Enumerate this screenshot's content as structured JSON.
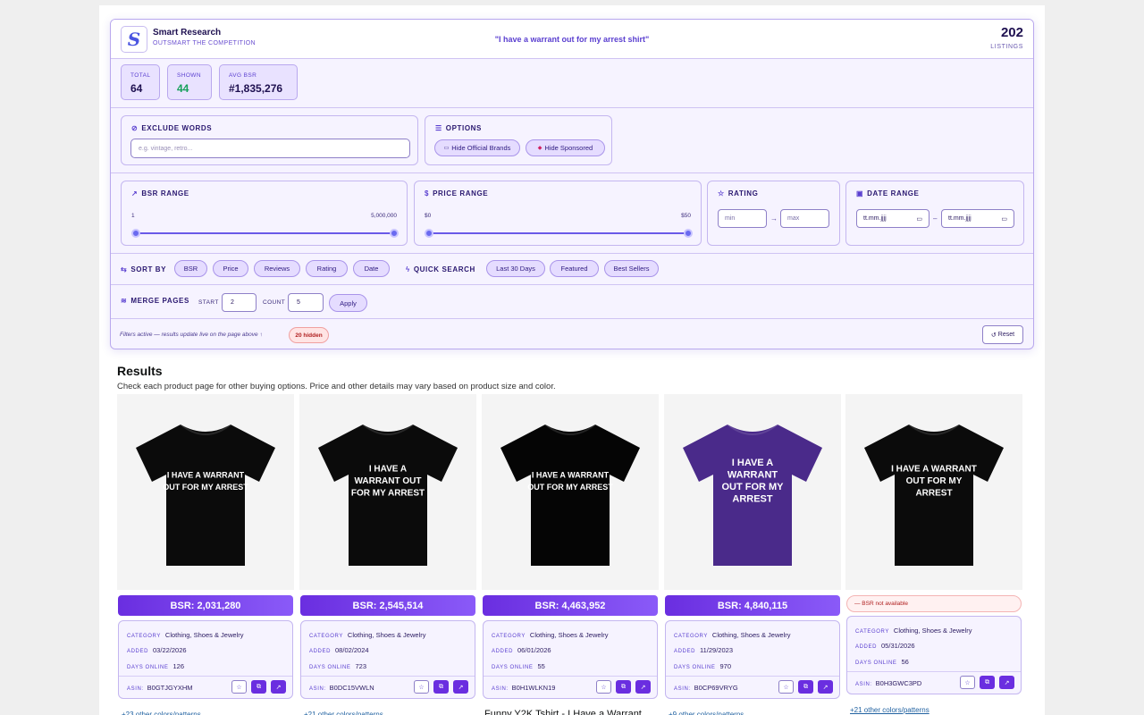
{
  "header": {
    "logo_letter": "S",
    "brand_name": "Smart Research",
    "tagline": "OUTSMART THE COMPETITION",
    "query": "\"I have a warrant out for my arrest shirt\"",
    "listing_count": "202",
    "listing_label": "LISTINGS"
  },
  "stats": [
    {
      "label": "TOTAL",
      "value": "64"
    },
    {
      "label": "SHOWN",
      "value": "44"
    },
    {
      "label": "AVG BSR",
      "value": "#1,835,276"
    }
  ],
  "exclude": {
    "title": "EXCLUDE WORDS",
    "placeholder": "e.g. vintage, retro..."
  },
  "options": {
    "title": "OPTIONS",
    "hide_official": "Hide Official Brands",
    "hide_sponsored": "Hide Sponsored"
  },
  "bsr_range": {
    "title": "BSR RANGE",
    "min_label": "1",
    "max_label": "5,000,000"
  },
  "price_range": {
    "title": "PRICE RANGE",
    "min_label": "$0",
    "max_label": "$50"
  },
  "rating": {
    "title": "RATING",
    "min_placeholder": "min",
    "max_placeholder": "max",
    "separator": "→"
  },
  "date_range": {
    "title": "DATE RANGE",
    "from_placeholder": "tt.mm.jjjj",
    "to_placeholder": "tt.mm.jjjj",
    "separator": "–"
  },
  "sort": {
    "label": "SORT BY",
    "options": [
      "BSR",
      "Price",
      "Reviews",
      "Rating",
      "Date"
    ]
  },
  "quick_search": {
    "label": "QUICK SEARCH",
    "options": [
      "Last 30 Days",
      "Featured",
      "Best Sellers"
    ]
  },
  "merge": {
    "label": "MERGE PAGES",
    "start_label": "START",
    "start_value": "2",
    "count_label": "COUNT",
    "count_value": "5",
    "apply_label": "Apply"
  },
  "footer": {
    "status_text": "Filters active — results update live on the page above ↑",
    "hidden_badge": "20 hidden",
    "reset_label": "Reset"
  },
  "results": {
    "title": "Results",
    "subtitle": "Check each product page for other buying options. Price and other details may vary based on product size and color."
  },
  "info_labels": {
    "category": "CATEGORY",
    "added": "ADDED",
    "days_online": "DAYS ONLINE",
    "asin": "ASIN:"
  },
  "products": [
    {
      "shirt_lines": [
        "I HAVE A WARRANT",
        "OUT FOR MY ARREST"
      ],
      "shirt_color": "#0b0b0b",
      "bsr": "BSR: 2,031,280",
      "category": "Clothing, Shoes & Jewelry",
      "added": "03/22/2026",
      "days_online": "126",
      "asin": "B0GTJGYXHM",
      "more_link": "+23 other colors/patterns",
      "title": ""
    },
    {
      "shirt_lines": [
        "I HAVE A",
        "WARRANT OUT",
        "FOR MY ARREST"
      ],
      "shirt_color": "#0b0b0b",
      "bsr": "BSR: 2,545,514",
      "category": "Clothing, Shoes & Jewelry",
      "added": "08/02/2024",
      "days_online": "723",
      "asin": "B0DC15VWLN",
      "more_link": "+21 other colors/patterns",
      "title": ""
    },
    {
      "shirt_lines": [
        "I HAVE A WARRANT",
        "OUT FOR MY ARREST"
      ],
      "shirt_color": "#050505",
      "bsr": "BSR: 4,463,952",
      "category": "Clothing, Shoes & Jewelry",
      "added": "06/01/2026",
      "days_online": "55",
      "asin": "B0H1WLKN19",
      "more_link": "",
      "title": "Funny Y2K Tshirt - I Have a Warrant"
    },
    {
      "shirt_lines": [
        "I HAVE A",
        "WARRANT",
        "OUT FOR MY",
        "ARREST"
      ],
      "shirt_color": "#4a2a8a",
      "bsr": "BSR: 4,840,115",
      "category": "Clothing, Shoes & Jewelry",
      "added": "11/29/2023",
      "days_online": "970",
      "asin": "B0CP69VRYG",
      "more_link": "+9 other colors/patterns",
      "title": ""
    },
    {
      "shirt_lines": [
        "I HAVE A WARRANT",
        "OUT FOR MY",
        "ARREST"
      ],
      "shirt_color": "#0b0b0b",
      "bsr": "",
      "bsr_na": "— BSR not available",
      "category": "Clothing, Shoes & Jewelry",
      "added": "05/31/2026",
      "days_online": "56",
      "asin": "B0H3GWC3PD",
      "more_link": "+21 other colors/patterns",
      "title": ""
    }
  ],
  "icons": {
    "exclude": "ban-icon",
    "options": "sliders-icon",
    "bsr": "trend-up-icon",
    "price": "dollar-icon",
    "rating": "star-icon",
    "date": "calendar-icon",
    "sort": "swap-icon",
    "quick": "bolt-icon",
    "merge": "layers-icon",
    "reset": "refresh-icon",
    "copy": "copy-icon",
    "open": "external-link-icon"
  },
  "colors": {
    "accent": "#6a2ee0",
    "panel_bg": "#f6f3ff",
    "border": "#b9a8ee",
    "green": "#15a05a"
  }
}
